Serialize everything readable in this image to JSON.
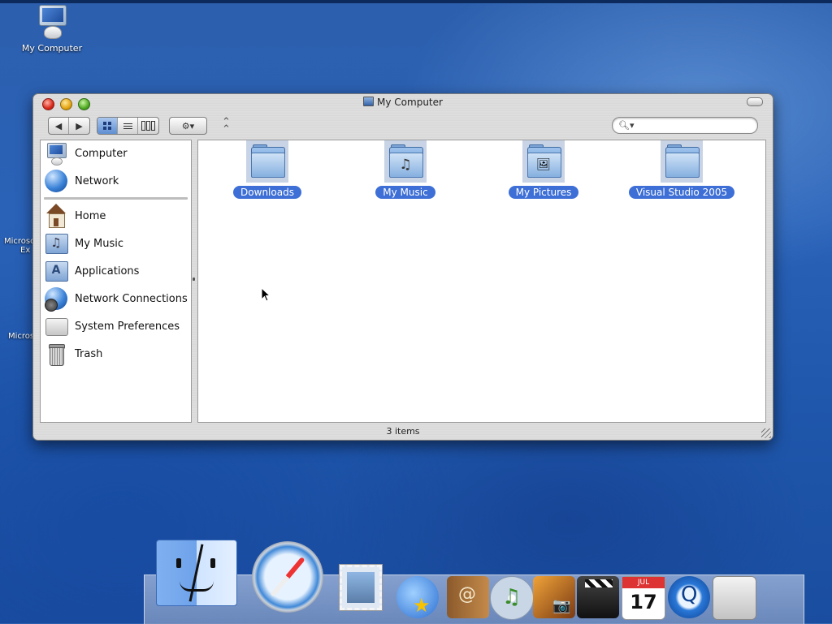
{
  "desktop": {
    "my_computer_label": "My Computer",
    "partial_label_1a": "Microso",
    "partial_label_1b": "Ex",
    "partial_label_2": "Micros"
  },
  "window": {
    "title": "My Computer",
    "search": {
      "placeholder": "",
      "value": ""
    },
    "status": "3 items"
  },
  "toolbar": {
    "back_glyph": "◀",
    "forward_glyph": "▶",
    "action_glyph": "⚙▾",
    "path_glyph": "⌃"
  },
  "sidebar": {
    "items": [
      {
        "label": "Computer",
        "icon": "computer-icon"
      },
      {
        "label": "Network",
        "icon": "network-globe-icon"
      },
      {
        "label": "Home",
        "icon": "home-icon"
      },
      {
        "label": "My Music",
        "icon": "music-folder-icon"
      },
      {
        "label": "Applications",
        "icon": "applications-icon"
      },
      {
        "label": "Network Connections",
        "icon": "network-connections-icon"
      },
      {
        "label": "System Preferences",
        "icon": "system-preferences-icon"
      },
      {
        "label": "Trash",
        "icon": "trash-icon"
      }
    ]
  },
  "files": [
    {
      "name": "Downloads",
      "icon": "folder-icon",
      "emblem": ""
    },
    {
      "name": "My Music",
      "icon": "music-folder-icon",
      "emblem": "♫"
    },
    {
      "name": "My Pictures",
      "icon": "pictures-folder-icon",
      "emblem": "🖼"
    },
    {
      "name": "Visual Studio 2005",
      "icon": "folder-icon",
      "emblem": ""
    }
  ],
  "dock": {
    "items": [
      {
        "name": "Finder",
        "icon": "finder-icon"
      },
      {
        "name": "Safari",
        "icon": "safari-icon"
      },
      {
        "name": "Mail",
        "icon": "mail-icon"
      },
      {
        "name": "iChat",
        "icon": "ichat-icon"
      },
      {
        "name": "Address Book",
        "icon": "address-book-icon"
      },
      {
        "name": "iTunes",
        "icon": "itunes-icon"
      },
      {
        "name": "iPhoto",
        "icon": "iphoto-icon"
      },
      {
        "name": "iMovie",
        "icon": "imovie-icon"
      },
      {
        "name": "iCal",
        "icon": "ical-icon",
        "month": "JUL",
        "day": "17"
      },
      {
        "name": "QuickTime",
        "icon": "quicktime-icon"
      },
      {
        "name": "System Preferences",
        "icon": "system-preferences-icon"
      }
    ]
  }
}
